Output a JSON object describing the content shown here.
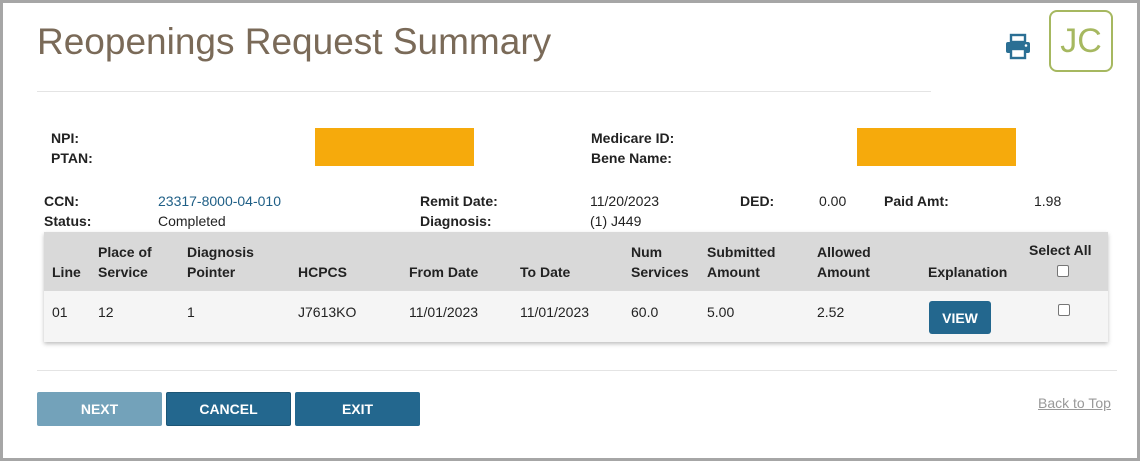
{
  "header": {
    "title": "Reopenings Request Summary",
    "avatar_initials": "JC",
    "print_icon": "printer-icon"
  },
  "provider": {
    "npi_label": "NPI:",
    "ptan_label": "PTAN:",
    "medicare_id_label": "Medicare ID:",
    "bene_name_label": "Bene Name:"
  },
  "claim": {
    "ccn_label": "CCN:",
    "ccn_value": "23317-8000-04-010",
    "status_label": "Status:",
    "status_value": "Completed",
    "remit_date_label": "Remit Date:",
    "remit_date_value": "11/20/2023",
    "diagnosis_label": "Diagnosis:",
    "diagnosis_value": "(1) J449",
    "ded_label": "DED:",
    "ded_value": "0.00",
    "paid_amt_label": "Paid Amt:",
    "paid_amt_value": "1.98"
  },
  "table": {
    "headers": {
      "line": "Line",
      "place_of_service_1": "Place of",
      "place_of_service_2": "Service",
      "diagnosis_pointer_1": "Diagnosis",
      "diagnosis_pointer_2": "Pointer",
      "hcpcs": "HCPCS",
      "from_date": "From Date",
      "to_date": "To Date",
      "num_services_1": "Num",
      "num_services_2": "Services",
      "submitted_amount_1": "Submitted",
      "submitted_amount_2": "Amount",
      "allowed_amount_1": "Allowed",
      "allowed_amount_2": "Amount",
      "explanation": "Explanation",
      "select_all": "Select All"
    },
    "rows": [
      {
        "line": "01",
        "place_of_service": "12",
        "diagnosis_pointer": "1",
        "hcpcs": "J7613KO",
        "from_date": "11/01/2023",
        "to_date": "11/01/2023",
        "num_services": "60.0",
        "submitted_amount": "5.00",
        "allowed_amount": "2.52",
        "view_label": "VIEW"
      }
    ]
  },
  "footer": {
    "next_label": "NEXT",
    "cancel_label": "CANCEL",
    "exit_label": "EXIT",
    "back_to_top": "Back to Top"
  },
  "colors": {
    "title": "#7a6a58",
    "primary_button": "#23678e",
    "disabled_button": "#73a2ba",
    "redaction": "#f6aa0c",
    "avatar": "#a6b860"
  }
}
